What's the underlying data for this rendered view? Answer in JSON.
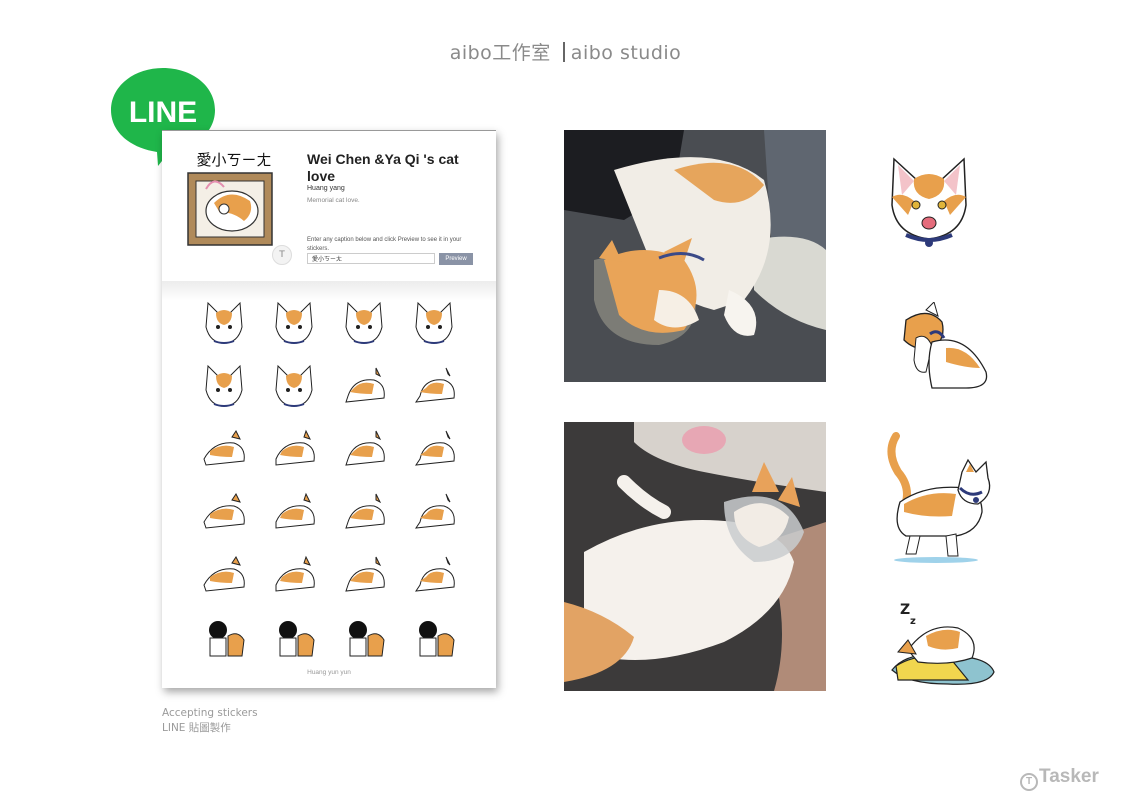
{
  "header": {
    "title_left": "aibo工作室",
    "title_right": "aibo studio"
  },
  "logo": {
    "text": "LINE",
    "color": "#1fb64a"
  },
  "store": {
    "title": "Wei Chen &Ya Qi 's cat love",
    "author": "Huang yang",
    "description": "Memorial cat love.",
    "hint": "Enter any caption below and click Preview to see it in your stickers.",
    "input_value": "愛小ㄎㄧㄤ",
    "preview_label": "Preview",
    "badge": "T",
    "main_sticker_text": "愛小ㄎㄧㄤ",
    "footer": "Huang yun yun",
    "sticker_count": 24
  },
  "caption": {
    "line1": "Accepting stickers",
    "line2": "LINE  貼圖製作"
  },
  "brand": {
    "watermark": "Tasker",
    "icon": "tasker-icon"
  },
  "colors": {
    "line_green": "#1fb64a",
    "cat_orange": "#e8a04c",
    "collar_navy": "#2d3a7a"
  }
}
